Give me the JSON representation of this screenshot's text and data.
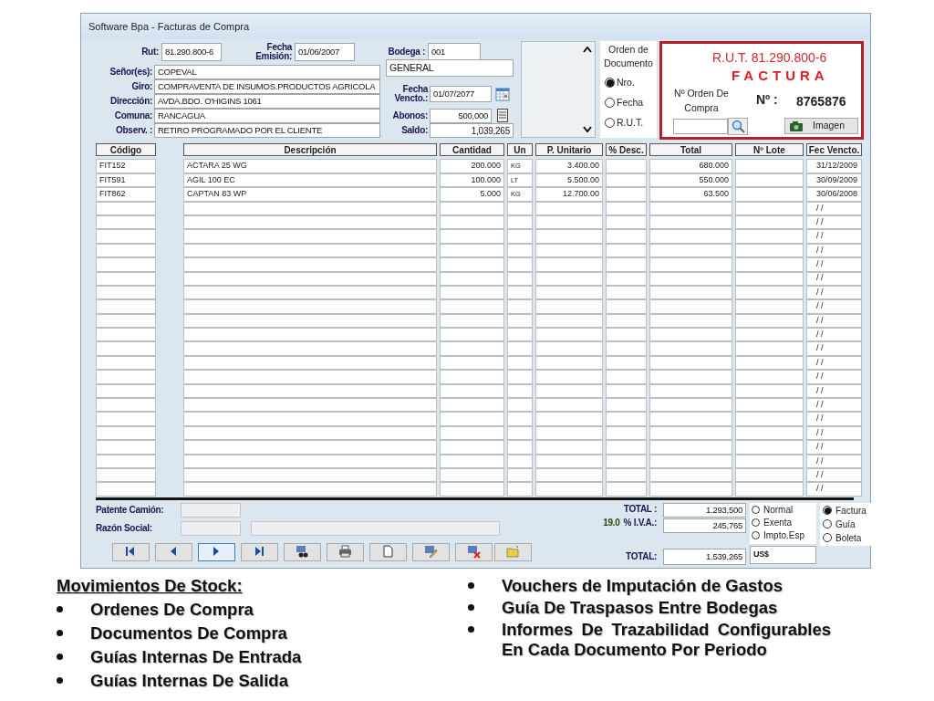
{
  "window": {
    "title": "Software Bpa - Facturas de Compra"
  },
  "header": {
    "rut": {
      "label": "Rut:",
      "value": "81.290.800-6"
    },
    "fecha_emision": {
      "label": "Fecha Emisión:",
      "value": "01/06/2007"
    },
    "bodega": {
      "label": "Bodega :",
      "value": "001"
    }
  },
  "bodega_nombre": "GENERAL",
  "customer_fields": [
    {
      "label": "Señor(es):",
      "value": "COPEVAL"
    },
    {
      "label": "Giro:",
      "value": "COMPRAVENTA DE INSUMOS.PRODUCTOS AGRICOLA"
    },
    {
      "label": "Dirección:",
      "value": "AVDA.BDO. O'HIGINS 1061"
    },
    {
      "label": "Comuna:",
      "value": "RANCAGUA"
    },
    {
      "label": "Observ. :",
      "value": "RETIRO PROGRAMADO POR EL CLIENTE"
    }
  ],
  "fecha_vencto": {
    "label": "Fecha Vencto.:",
    "value": "01/07/2077"
  },
  "abonos": {
    "label": "Abonos:",
    "value": "500,000"
  },
  "saldo": {
    "label": "Saldo:",
    "value": "1,039,265"
  },
  "orden": {
    "title": "Orden de Documento",
    "options": [
      {
        "label": "Nro.",
        "selected": true
      },
      {
        "label": "Fecha",
        "selected": false
      },
      {
        "label": "R.U.T.",
        "selected": false
      }
    ]
  },
  "factura": {
    "rut": "R.U.T. 81.290.800-6",
    "tipo": "FACTURA",
    "orden_label": "Nº Orden De Compra",
    "numero_label": "Nº :",
    "numero": "8765876",
    "imagen_button": "Imagen"
  },
  "table": {
    "columns": [
      "Código",
      "Descripción",
      "Cantidad",
      "Un",
      "P. Unitario",
      "% Desc.",
      "Total",
      "Nº Lote",
      "Fec Vencto."
    ],
    "rows": [
      {
        "codigo": "FIT152",
        "descripcion": "ACTARA 25 WG",
        "cantidad": "200.000",
        "un": "KG",
        "p_unitario": "3.400.00",
        "total": "680.000",
        "fec_vencto": "31/12/2009"
      },
      {
        "codigo": "FIT591",
        "descripcion": "AGIL 100 EC",
        "cantidad": "100.000",
        "un": "LT",
        "p_unitario": "5.500.00",
        "total": "550.000",
        "fec_vencto": "30/09/2009"
      },
      {
        "codigo": "FIT862",
        "descripcion": "CAPTAN 83 WP",
        "cantidad": "5.000",
        "un": "KG",
        "p_unitario": "12.700.00",
        "total": "63.500",
        "fec_vencto": "30/06/2008"
      },
      {
        "fec_vencto": "/ /"
      },
      {
        "fec_vencto": "/ /"
      },
      {
        "fec_vencto": "/ /"
      },
      {
        "fec_vencto": "/ /"
      },
      {
        "fec_vencto": "/ /"
      },
      {
        "fec_vencto": "/ /"
      },
      {
        "fec_vencto": "/ /"
      },
      {
        "fec_vencto": "/ /"
      },
      {
        "fec_vencto": "/ /"
      },
      {
        "fec_vencto": "/ /"
      },
      {
        "fec_vencto": "/ /"
      },
      {
        "fec_vencto": "/ /"
      },
      {
        "fec_vencto": "/ /"
      },
      {
        "fec_vencto": "/ /"
      },
      {
        "fec_vencto": "/ /"
      },
      {
        "fec_vencto": "/ /"
      },
      {
        "fec_vencto": "/ /"
      },
      {
        "fec_vencto": "/ /"
      },
      {
        "fec_vencto": "/ /"
      },
      {
        "fec_vencto": "/ /"
      },
      {
        "fec_vencto": "/ /"
      }
    ]
  },
  "patente_label": "Patente Camión:",
  "razon_label": "Razón Social:",
  "toolbar": [
    {
      "kind": "first",
      "focused": false
    },
    {
      "kind": "prev",
      "focused": false
    },
    {
      "kind": "next",
      "focused": true
    },
    {
      "kind": "last",
      "focused": false
    },
    {
      "kind": "find",
      "focused": false
    },
    {
      "kind": "print",
      "focused": false
    },
    {
      "kind": "new",
      "focused": false
    },
    {
      "kind": "edit",
      "focused": false
    },
    {
      "kind": "delete",
      "focused": false
    },
    {
      "kind": "folder",
      "focused": false
    }
  ],
  "totals": {
    "neto_label": "TOTAL :",
    "neto": "1.293,500",
    "iva_rate": "19.0",
    "iva_label": "% I.V.A.:",
    "iva": "245,765",
    "total_label": "TOTAL:",
    "total": "1.539,265",
    "moneda": "US$"
  },
  "tipo_venta": [
    {
      "label": "Normal",
      "selected": false
    },
    {
      "label": "Exenta",
      "selected": false
    },
    {
      "label": "Impto.Esp",
      "selected": false
    }
  ],
  "tipo_documento": [
    {
      "label": "Factura",
      "selected": true
    },
    {
      "label": "Guía",
      "selected": false
    },
    {
      "label": "Boleta",
      "selected": false
    }
  ],
  "slide": {
    "heading": "Movimientos De Stock:",
    "left_items": [
      "Ordenes De Compra",
      "Documentos De Compra",
      "Guías Internas De Entrada",
      "Guías Internas De Salida"
    ],
    "right_items": [
      "Vouchers de Imputación de Gastos",
      "Guía De Traspasos Entre Bodegas",
      "Informes De Trazabilidad Configurables En Cada Documento Por Periodo"
    ]
  }
}
